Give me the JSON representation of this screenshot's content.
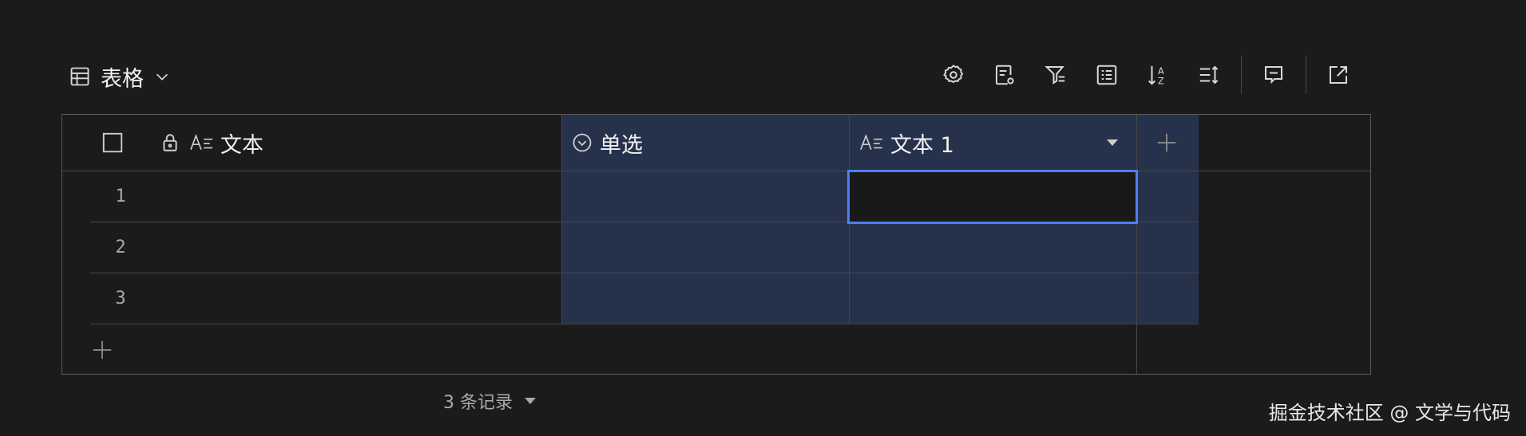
{
  "view": {
    "title": "表格",
    "icon": "table-icon",
    "dropdown_icon": "chevron-down-icon"
  },
  "toolbar": {
    "buttons": [
      {
        "name": "settings-icon"
      },
      {
        "name": "field-settings-icon"
      },
      {
        "name": "filter-icon"
      },
      {
        "name": "group-icon"
      },
      {
        "name": "sort-icon"
      },
      {
        "name": "row-height-icon"
      },
      {
        "name": "comment-icon"
      },
      {
        "name": "share-icon"
      }
    ]
  },
  "columns": [
    {
      "label": "文本",
      "icon": "text-field-icon",
      "locked": true
    },
    {
      "label": "单选",
      "icon": "single-select-icon"
    },
    {
      "label": "文本 1",
      "icon": "text-field-icon",
      "has_menu": true
    }
  ],
  "rows": [
    {
      "num": "1"
    },
    {
      "num": "2"
    },
    {
      "num": "3"
    }
  ],
  "footer": {
    "record_count": "3 条记录"
  },
  "watermark": "掘金技术社区 @ 文学与代码",
  "colors": {
    "background": "#1b1b1b",
    "selected_column": "#26314b",
    "active_border": "#4f7ef0"
  }
}
